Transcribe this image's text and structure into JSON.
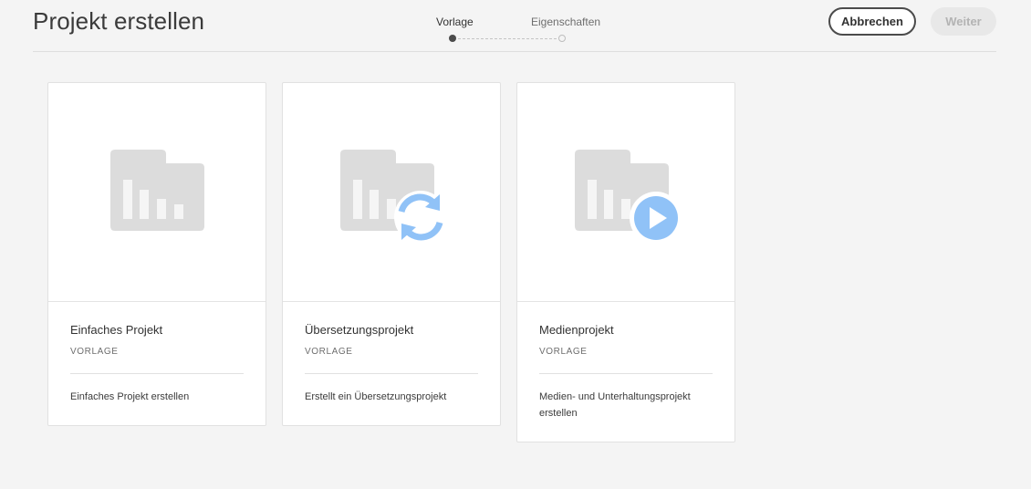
{
  "header": {
    "title": "Projekt erstellen",
    "steps": [
      {
        "label": "Vorlage",
        "state": "active"
      },
      {
        "label": "Eigenschaften",
        "state": "inactive"
      }
    ],
    "cancel_label": "Abbrechen",
    "next_label": "Weiter"
  },
  "cards": [
    {
      "title": "Einfaches Projekt",
      "subtitle": "VORLAGE",
      "description": "Einfaches Projekt erstellen",
      "icon": "folder-chart-icon"
    },
    {
      "title": "Übersetzungsprojekt",
      "subtitle": "VORLAGE",
      "description": "Erstellt ein Übersetzungsprojekt",
      "icon": "folder-chart-sync-icon"
    },
    {
      "title": "Medienprojekt",
      "subtitle": "VORLAGE",
      "description": "Medien- und Unterhaltungsprojekt erstellen",
      "icon": "folder-chart-play-icon"
    }
  ],
  "colors": {
    "background": "#f4f4f4",
    "folder_gray": "#dcdcdc",
    "accent_blue": "#90c2f7"
  }
}
